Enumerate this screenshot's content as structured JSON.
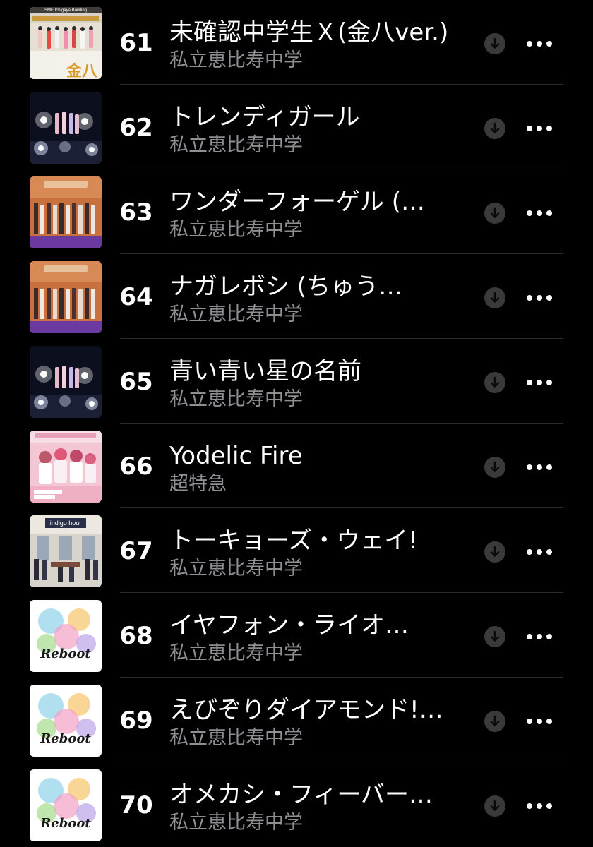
{
  "colors": {
    "background": "#000000",
    "title": "#ffffff",
    "subtitle": "#8e8e93",
    "icon_circle": "#3a3a3c",
    "icon_glyph": "#0a0a0a",
    "separator": "#2c2c2e"
  },
  "tracks": [
    {
      "number": "61",
      "title": "未確認中学生Ｘ(金八ver.)",
      "artist": "私立恵比寿中学",
      "artwork": "kinpachi",
      "download_icon": "download-arrow-icon",
      "more_icon": "ellipsis-icon"
    },
    {
      "number": "62",
      "title": "トレンディガール",
      "artist": "私立恵比寿中学",
      "artwork": "night-lights",
      "download_icon": "download-arrow-icon",
      "more_icon": "ellipsis-icon"
    },
    {
      "number": "63",
      "title": "ワンダーフォーゲル (…",
      "artist": "私立恵比寿中学",
      "artwork": "stage-group",
      "download_icon": "download-arrow-icon",
      "more_icon": "ellipsis-icon"
    },
    {
      "number": "64",
      "title": "ナガレボシ (ちゅう…",
      "artist": "私立恵比寿中学",
      "artwork": "stage-group",
      "download_icon": "download-arrow-icon",
      "more_icon": "ellipsis-icon"
    },
    {
      "number": "65",
      "title": "青い青い星の名前",
      "artist": "私立恵比寿中学",
      "artwork": "night-lights",
      "download_icon": "download-arrow-icon",
      "more_icon": "ellipsis-icon"
    },
    {
      "number": "66",
      "title": "Yodelic Fire",
      "artist": "超特急",
      "artwork": "pink-group",
      "download_icon": "download-arrow-icon",
      "more_icon": "ellipsis-icon"
    },
    {
      "number": "67",
      "title": "トーキョーズ・ウェイ!",
      "artist": "私立恵比寿中学",
      "artwork": "indigo-hour",
      "download_icon": "download-arrow-icon",
      "more_icon": "ellipsis-icon"
    },
    {
      "number": "68",
      "title": "イヤフォン・ライオ…",
      "artist": "私立恵比寿中学",
      "artwork": "reboot",
      "download_icon": "download-arrow-icon",
      "more_icon": "ellipsis-icon"
    },
    {
      "number": "69",
      "title": "えびぞりダイアモンド!…",
      "artist": "私立恵比寿中学",
      "artwork": "reboot",
      "download_icon": "download-arrow-icon",
      "more_icon": "ellipsis-icon"
    },
    {
      "number": "70",
      "title": "オメカシ・フィーバー…",
      "artist": "私立恵比寿中学",
      "artwork": "reboot",
      "download_icon": "download-arrow-icon",
      "more_icon": "ellipsis-icon"
    }
  ],
  "artwork_text": {
    "kinpachi": {
      "top_banner": "SME Ichigaya Building",
      "badge": "金八"
    },
    "indigo-hour": {
      "banner": "indigo hour"
    },
    "reboot": {
      "word": "Reboot"
    }
  }
}
